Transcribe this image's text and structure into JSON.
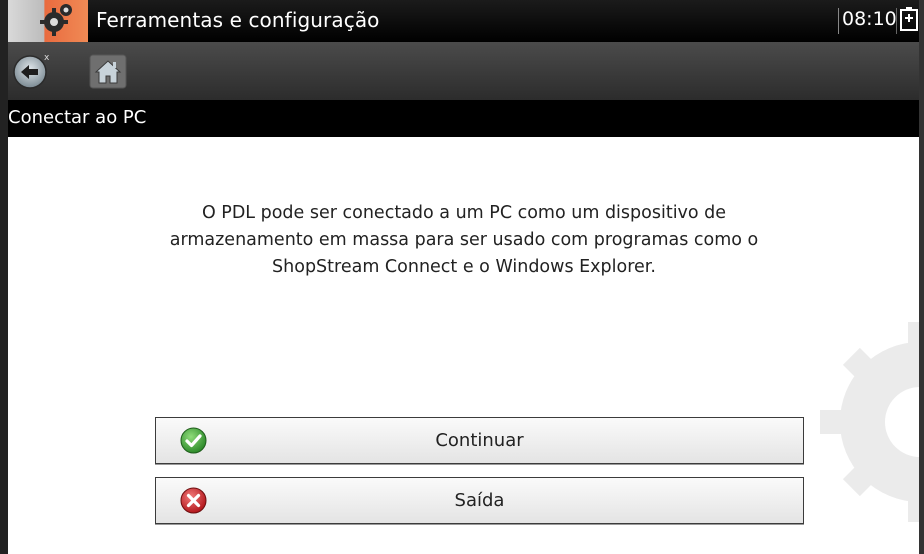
{
  "title_bar": {
    "app_icon": "gear-icon",
    "title": "Ferramentas e configuração",
    "time": "08:10",
    "battery_icon": "battery-charging-icon"
  },
  "toolbar": {
    "back_icon": "back-arrow-icon",
    "home_icon": "home-icon"
  },
  "breadcrumb": "Conectar ao PC",
  "main": {
    "message": "O PDL pode ser conectado a um PC como um dispositivo de armazenamento em massa para ser usado com programas como o ShopStream Connect e o Windows Explorer."
  },
  "buttons": {
    "continue_label": "Continuar",
    "continue_icon": "green-check-icon",
    "exit_label": "Saída",
    "exit_icon": "red-x-icon"
  },
  "colors": {
    "accent_orange": "#f08a55",
    "check_green": "#38a63a",
    "exit_red": "#d0262b"
  }
}
